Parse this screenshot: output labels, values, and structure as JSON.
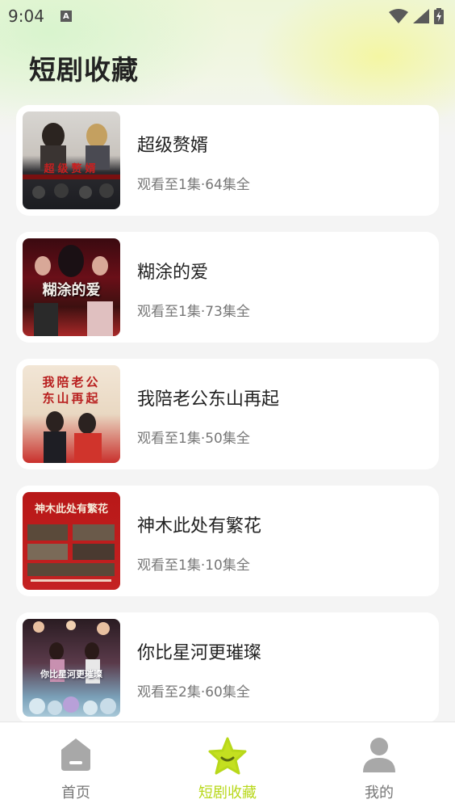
{
  "status_bar": {
    "time": "9:04",
    "notification_icon": "A"
  },
  "page": {
    "title": "短剧收藏"
  },
  "favorites": [
    {
      "title": "超级赘婿",
      "progress": "观看至1集·64集全"
    },
    {
      "title": "糊涂的爱",
      "progress": "观看至1集·73集全"
    },
    {
      "title": "我陪老公东山再起",
      "progress": "观看至1集·50集全"
    },
    {
      "title": "神木此处有繁花",
      "progress": "观看至1集·10集全"
    },
    {
      "title": "你比星河更璀璨",
      "progress": "观看至2集·60集全"
    }
  ],
  "posters": [
    {
      "overlay_text": "超级赘婿"
    },
    {
      "overlay_text": "糊涂的爱"
    },
    {
      "overlay_text_line1": "我陪老公",
      "overlay_text_line2": "东山再起"
    },
    {
      "overlay_text": "神木此处有繁花"
    },
    {
      "overlay_text": "你比星河更璀璨"
    }
  ],
  "bottom_nav": {
    "items": [
      {
        "label": "首页",
        "icon": "home-icon",
        "active": false
      },
      {
        "label": "短剧收藏",
        "icon": "star-icon",
        "active": true
      },
      {
        "label": "我的",
        "icon": "user-icon",
        "active": false
      }
    ]
  },
  "colors": {
    "accent": "#b8d81a",
    "inactive": "#9a9a9a",
    "title": "#222222"
  }
}
